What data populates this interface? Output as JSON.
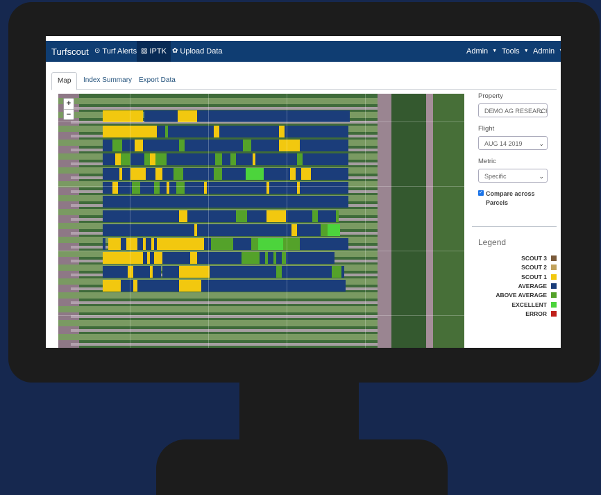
{
  "navbar": {
    "brand": "Turfscout",
    "items": [
      {
        "label": "Turf Alerts",
        "icon": "alert-circle-icon"
      },
      {
        "label": "IPTK",
        "icon": "image-icon"
      },
      {
        "label": "Upload Data",
        "icon": "gear-icon"
      }
    ],
    "right": [
      "Admin",
      "Tools",
      "Admin"
    ]
  },
  "tabs": [
    "Map",
    "Index Summary",
    "Export Data"
  ],
  "map": {
    "zoom_in": "+",
    "zoom_out": "−"
  },
  "sidebar": {
    "property_label": "Property",
    "property_value": "DEMO AG RESEARCH",
    "flight_label": "Flight",
    "flight_value": "AUG 14 2019",
    "metric_label": "Metric",
    "metric_value": "Specific",
    "compare_label": "Compare across Parcels",
    "compare_checked": true
  },
  "legend": {
    "title": "Legend",
    "items": [
      {
        "label": "SCOUT 3",
        "color": "#7a5a3a"
      },
      {
        "label": "SCOUT 2",
        "color": "#c2a25c"
      },
      {
        "label": "SCOUT 1",
        "color": "#f2c80f"
      },
      {
        "label": "AVERAGE",
        "color": "#1b3d7a"
      },
      {
        "label": "ABOVE AVERAGE",
        "color": "#54a22a"
      },
      {
        "label": "EXCELLENT",
        "color": "#4cd43c"
      },
      {
        "label": "ERROR",
        "color": "#c0201a"
      }
    ]
  }
}
